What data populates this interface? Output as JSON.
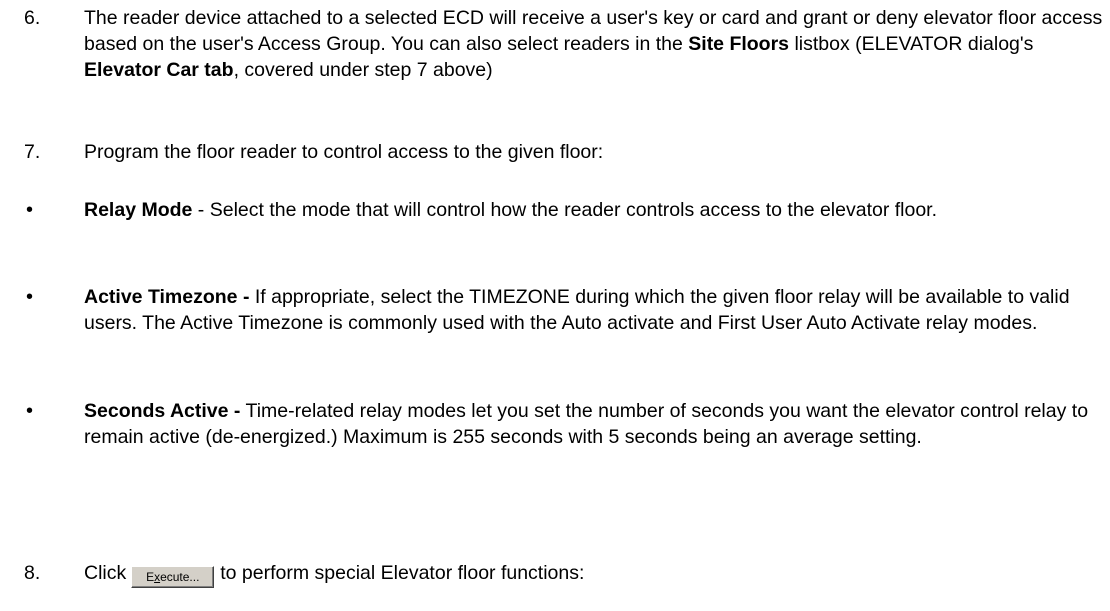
{
  "steps": {
    "step6": {
      "number": "6.",
      "text": "The reader device attached to a selected ECD will receive a user's key or card and grant or deny elevator floor access based on the user's Access Group. You can also select readers in the ",
      "bold1": "Site Floors",
      "text2": " listbox (ELEVATOR dialog's ",
      "bold2": "Elevator Car tab",
      "text3": ", covered under step 7 above)"
    },
    "step7": {
      "number": "7.",
      "text": "Program the floor reader to control access to the given floor:"
    },
    "step8": {
      "number": "8.",
      "prefix": "Click",
      "suffix": "to perform special Elevator floor functions:"
    }
  },
  "bullets": [
    {
      "symbol": "•",
      "title": "Relay Mode",
      "separator": " - ",
      "text": "Select the mode that will control how the reader controls access to the elevator floor."
    },
    {
      "symbol": "•",
      "title": "Active Timezone -",
      "separator": " ",
      "text": "If appropriate, select the TIMEZONE during which the given floor relay will be available to valid users. The Active Timezone is commonly used with the Auto activate and First User Auto Activate relay modes."
    },
    {
      "symbol": "•",
      "title": "Seconds Active -",
      "separator": " ",
      "text": "Time-related relay modes let you set the number of seconds you want the elevator control relay to remain active (de-energized.) Maximum is 255 seconds with 5 seconds being an average setting."
    }
  ],
  "execute_button": {
    "label_pre": "E",
    "label_accel": "x",
    "label_post": "ecute..."
  }
}
